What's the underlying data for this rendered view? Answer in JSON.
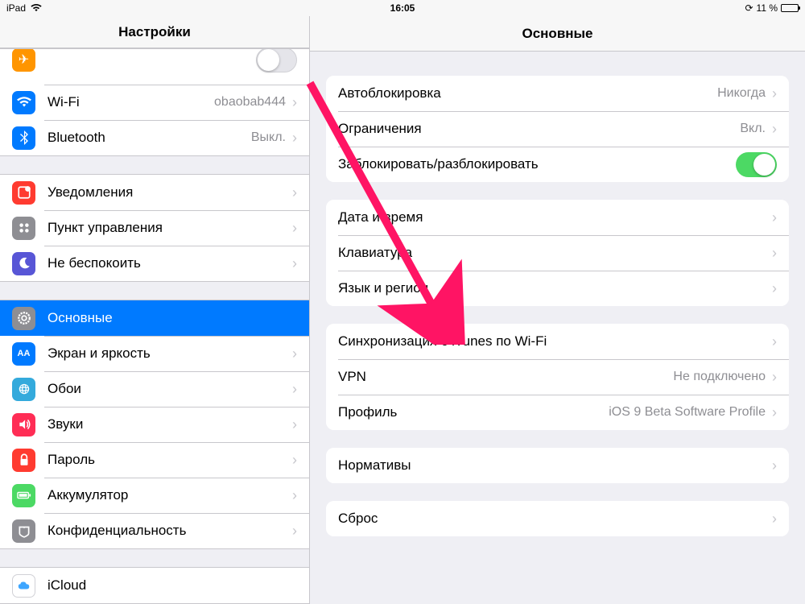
{
  "statusbar": {
    "device": "iPad",
    "time": "16:05",
    "battery_text": "11 %"
  },
  "sidebar": {
    "title": "Настройки",
    "rows": {
      "airplane": "",
      "wifi": "Wi-Fi",
      "wifi_value": "obaobab444",
      "bluetooth": "Bluetooth",
      "bluetooth_value": "Выкл.",
      "notifications": "Уведомления",
      "control_center": "Пункт управления",
      "dnd": "Не беспокоить",
      "general": "Основные",
      "display": "Экран и яркость",
      "wallpaper": "Обои",
      "sounds": "Звуки",
      "password": "Пароль",
      "battery": "Аккумулятор",
      "privacy": "Конфиденциальность",
      "icloud": "iCloud"
    }
  },
  "detail": {
    "title": "Основные",
    "group1": {
      "autolock_label": "Автоблокировка",
      "autolock_value": "Никогда",
      "restrictions_label": "Ограничения",
      "restrictions_value": "Вкл.",
      "lockunlock_label": "Заблокировать/разблокировать"
    },
    "group2": {
      "datetime": "Дата и время",
      "keyboard": "Клавиатура",
      "language": "Язык и регион"
    },
    "group3": {
      "itunes_wifi_sync": "Синхронизация с iTunes по Wi-Fi",
      "vpn_label": "VPN",
      "vpn_value": "Не подключено",
      "profile_label": "Профиль",
      "profile_value": "iOS 9 Beta Software Profile"
    },
    "group4": {
      "regulatory": "Нормативы"
    },
    "group5": {
      "reset": "Сброс"
    }
  }
}
